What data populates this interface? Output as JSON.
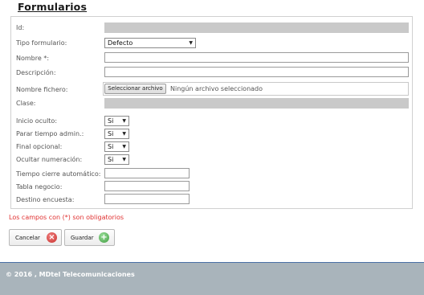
{
  "page": {
    "title": "Formularios"
  },
  "form": {
    "labels": {
      "id": "Id:",
      "tipo_formulario": "Tipo formulario:",
      "nombre": "Nombre *:",
      "descripcion": "Descripción:",
      "nombre_fichero": "Nombre fichero:",
      "clase": "Clase:",
      "inicio_oculto": "Inicio oculto:",
      "parar_tiempo": "Parar tiempo admin.:",
      "final_opcional": "Final opcional:",
      "ocultar_numeracion": "Ocultar numeración:",
      "tiempo_cierre": "Tiempo cierre automático:",
      "tabla_negocio": "Tabla negocio:",
      "destino_encuesta": "Destino encuesta:"
    },
    "values": {
      "id": "",
      "tipo_formulario": "Defecto",
      "nombre": "",
      "descripcion": "",
      "clase": "",
      "inicio_oculto": "Si",
      "parar_tiempo": "Si",
      "final_opcional": "Si",
      "ocultar_numeracion": "Si",
      "tiempo_cierre": "",
      "tabla_negocio": "",
      "destino_encuesta": ""
    },
    "file": {
      "button_label": "Seleccionar archivo",
      "status": "Ningún archivo seleccionado"
    },
    "required_note": "Los campos con (*) son obligatorios"
  },
  "buttons": {
    "cancel_label": "Cancelar",
    "save_label": "Guardar"
  },
  "footer": {
    "text": "© 2016 , MDtel Telecomunicaciones"
  },
  "colors": {
    "required_note": "#e03030",
    "cancel_icon": "#d9534f",
    "save_icon": "#5cb85c",
    "footer_bg": "#a9b4bb",
    "footer_border": "#4a6fa5"
  },
  "icons": {
    "cancel": "close-icon",
    "save": "plus-icon"
  }
}
